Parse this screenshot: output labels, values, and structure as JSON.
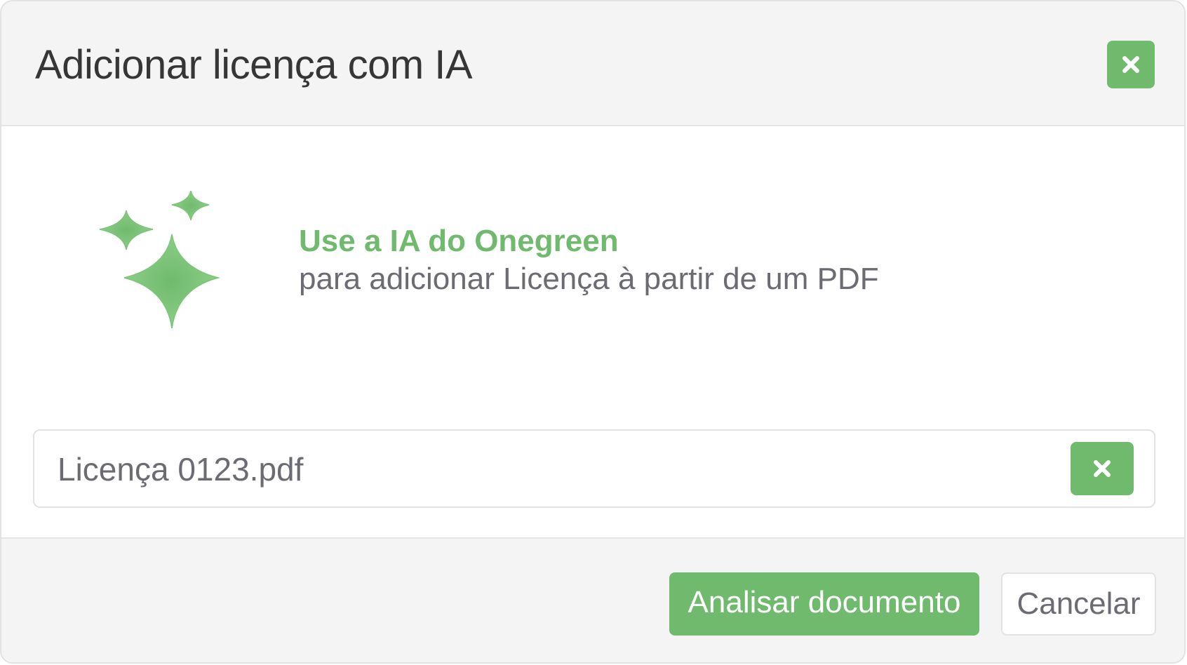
{
  "modal": {
    "title": "Adicionar licença com IA",
    "close_icon": "close-icon"
  },
  "body": {
    "ai_icon": "sparkles-icon",
    "ai_title": "Use a IA do Onegreen",
    "ai_subtitle": "para adicionar Licença à partir de um PDF",
    "file": {
      "name": "Licença 0123.pdf",
      "remove_icon": "close-icon"
    }
  },
  "footer": {
    "analyze_label": "Analisar documento",
    "cancel_label": "Cancelar"
  },
  "colors": {
    "accent": "#6fba6c",
    "header_bg": "#f4f4f4",
    "text_dark": "#363636",
    "text_muted": "#6b6b73",
    "border": "#e2e2e2"
  }
}
